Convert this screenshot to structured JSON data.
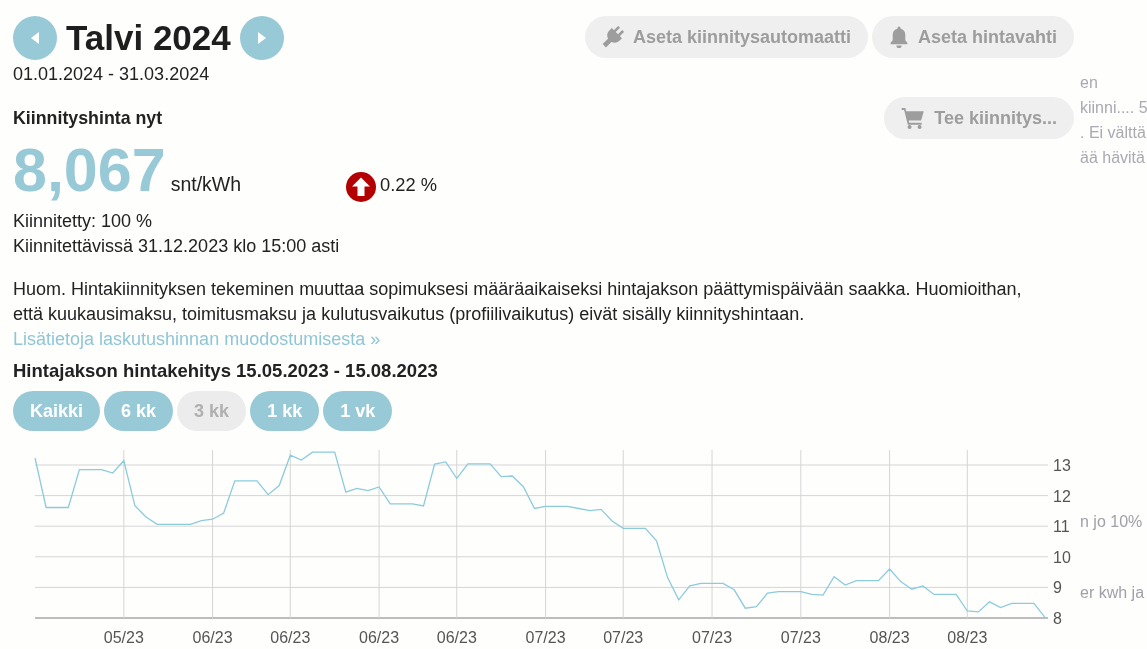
{
  "header": {
    "title": "Talvi 2024",
    "date_range": "01.01.2024 - 31.03.2024"
  },
  "actions": {
    "auto_fix_button": {
      "label": "Aseta kiinnitysautomaatti",
      "disabled": true
    },
    "price_alert_button": {
      "label": "Aseta hintavahti",
      "disabled": true
    }
  },
  "price_now": {
    "heading": "Kiinnityshinta nyt",
    "fix_button": {
      "label": "Tee kiinnitys...",
      "disabled": true
    },
    "price": "8,067",
    "unit": "snt/kWh",
    "rising": true,
    "change": "0.22 %"
  },
  "fixed_share": "Kiinnitetty: 100 %",
  "deadline": "Kiinnitettävissä 31.12.2023 klo 15:00 asti",
  "notice": "Huom. Hintakiinnityksen tekeminen muuttaa sopimuksesi määräaikaiseksi hintajakson päättymispäivään saakka. Huomioithan, että kuukausimaksu, toimitusmaksu ja kulutusvaikutus (profiilivaikutus) eivät sisälly kiinnityshintaan.",
  "info_link": "Lisätietoja laskutushinnan muodostumisesta »",
  "history": {
    "title": "Hintajakson hintakehitys 15.05.2023 - 15.08.2023",
    "ranges": [
      {
        "label": "Kaikki",
        "selected": false
      },
      {
        "label": "6 kk",
        "selected": false
      },
      {
        "label": "3 kk",
        "selected": true
      },
      {
        "label": "1 kk",
        "selected": false
      },
      {
        "label": "1 vk",
        "selected": false
      }
    ],
    "x_axis_labels": [
      "05/23",
      "06/23",
      "06/23",
      "06/23",
      "06/23",
      "07/23",
      "07/23",
      "07/23",
      "07/23",
      "08/23",
      "08/23"
    ],
    "chart_data": {
      "type": "line",
      "values": [
        13.23,
        11.61,
        11.61,
        11.61,
        12.85,
        12.85,
        12.85,
        12.74,
        13.14,
        11.67,
        11.3,
        11.06,
        11.06,
        11.06,
        11.06,
        11.18,
        11.23,
        11.43,
        12.48,
        12.48,
        12.48,
        12.03,
        12.33,
        13.32,
        13.16,
        13.42,
        13.42,
        13.42,
        12.11,
        12.24,
        12.16,
        12.28,
        11.73,
        11.73,
        11.73,
        11.66,
        13.03,
        13.1,
        12.56,
        13.04,
        13.04,
        13.04,
        12.62,
        12.64,
        12.29,
        11.58,
        11.65,
        11.65,
        11.65,
        11.58,
        11.51,
        11.55,
        11.17,
        10.93,
        10.93,
        10.93,
        10.52,
        9.32,
        8.59,
        9.05,
        9.13,
        9.13,
        9.13,
        8.92,
        8.32,
        8.37,
        8.81,
        8.86,
        8.86,
        8.86,
        8.77,
        8.75,
        9.35,
        9.08,
        9.22,
        9.22,
        9.22,
        9.6,
        9.19,
        8.94,
        9.05,
        8.77,
        8.77,
        8.77,
        8.23,
        8.2,
        8.53,
        8.34,
        8.48,
        8.48,
        8.48,
        8.02
      ],
      "ylim": [
        8,
        13.5
      ],
      "yticks": [
        8,
        9,
        10,
        11,
        12,
        13
      ],
      "grid": true
    }
  },
  "background_window": {
    "upper_lines": [
      "en",
      "kiinni.... 5",
      ". Ei välttä",
      "ää hävitä"
    ],
    "lower_lines": [
      "n jo 10%",
      "er kwh ja"
    ]
  }
}
